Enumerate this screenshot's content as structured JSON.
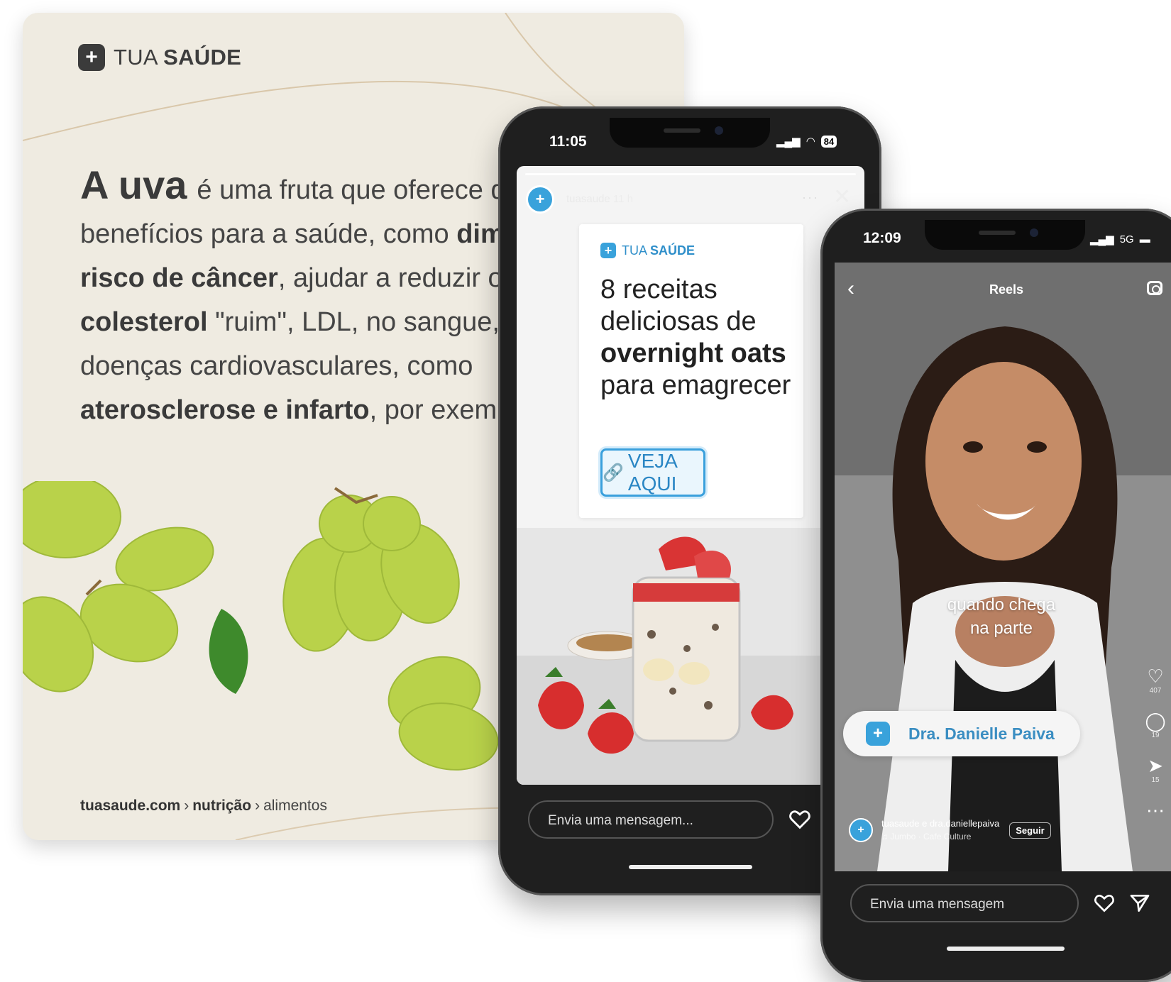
{
  "card": {
    "brand": {
      "prefix": "TUA ",
      "bold": "SAÚDE"
    },
    "text": {
      "big": "A uva",
      "p1": "é uma fruta que oferece diversos benefícios para a saúde, como ",
      "b1": "diminuir o risco de câncer",
      "p2": ", ajudar a reduzir os ",
      "b2": "níveis de colesterol",
      "p3": " \"ruim\", LDL, no sangue, evitando doenças cardiovasculares, como ",
      "b3": "aterosclerose e infarto",
      "p4": ", por exemplo."
    },
    "breadcrumb": {
      "site": "tuasaude.com",
      "sep": "›",
      "section": "nutrição",
      "page": "alimentos"
    }
  },
  "phone1": {
    "time": "11:05",
    "battery": "84",
    "story": {
      "user": "tuasaude",
      "age": "11 h",
      "more": "···",
      "close": "✕",
      "brand": {
        "prefix": "TUA ",
        "bold": "SAÚDE"
      },
      "title": {
        "l1": "8 receitas deliciosas de ",
        "bold": "overnight oats",
        "l2": " para emagrecer"
      },
      "button": "VEJA AQUI"
    },
    "message_placeholder": "Envia uma mensagem..."
  },
  "phone2": {
    "time": "12:09",
    "network": "5G",
    "header": {
      "title": "Reels"
    },
    "caption": "quando chega na parte",
    "name_pill": "Dra. Danielle Paiva",
    "counts": {
      "likes": "407",
      "comments": "19",
      "shares": "15"
    },
    "author": {
      "names": "tuasaude e dra.daniellepaiva",
      "music": "♫ Jumbo · Cafe Culture",
      "follow": "Seguir"
    },
    "message_placeholder": "Envia uma mensagem"
  },
  "colors": {
    "brand_blue": "#39a2db",
    "card_bg": "#efebe1",
    "grape": "#b7d048"
  }
}
